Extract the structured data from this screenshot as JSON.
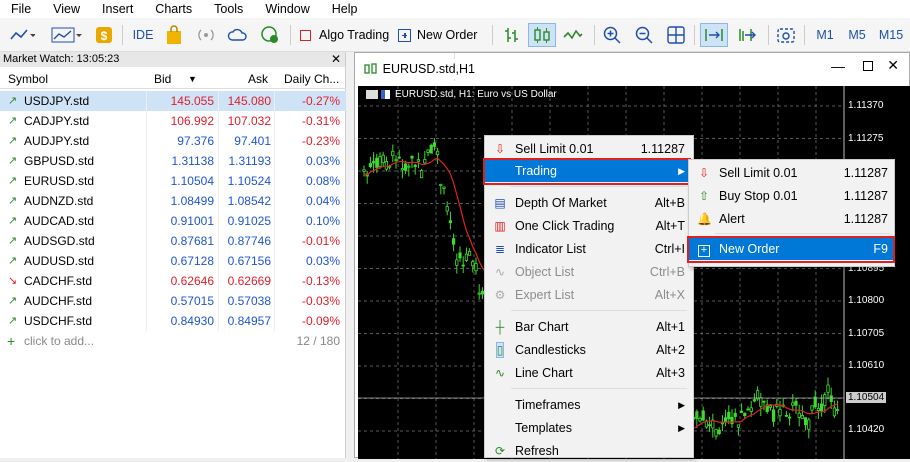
{
  "menu": {
    "file": "File",
    "view": "View",
    "insert": "Insert",
    "charts": "Charts",
    "tools": "Tools",
    "window": "Window",
    "help": "Help"
  },
  "toolbar": {
    "ide": "IDE",
    "algo": "Algo Trading",
    "new_order": "New Order",
    "m1": "M1",
    "m5": "M5",
    "m15": "M15"
  },
  "market_watch": {
    "title": "Market Watch: 13:05:23",
    "headers": {
      "symbol": "Symbol",
      "bid": "Bid",
      "ask": "Ask",
      "change": "Daily Ch..."
    },
    "rows": [
      {
        "symbol": "USDJPY.std",
        "bid": "145.055",
        "ask": "145.080",
        "change": "-0.27%",
        "dir": "up",
        "bid_color": "#e0202a",
        "chg_color": "#e0202a",
        "selected": true
      },
      {
        "symbol": "CADJPY.std",
        "bid": "106.992",
        "ask": "107.032",
        "change": "-0.31%",
        "dir": "up",
        "bid_color": "#e0202a",
        "chg_color": "#e0202a"
      },
      {
        "symbol": "AUDJPY.std",
        "bid": "97.376",
        "ask": "97.401",
        "change": "-0.23%",
        "dir": "up",
        "bid_color": "#1f55d6",
        "chg_color": "#e0202a"
      },
      {
        "symbol": "GBPUSD.std",
        "bid": "1.31138",
        "ask": "1.31193",
        "change": "0.03%",
        "dir": "up",
        "bid_color": "#1f55d6",
        "chg_color": "#1f55d6"
      },
      {
        "symbol": "EURUSD.std",
        "bid": "1.10504",
        "ask": "1.10524",
        "change": "0.08%",
        "dir": "up",
        "bid_color": "#1f55d6",
        "chg_color": "#1f55d6"
      },
      {
        "symbol": "AUDNZD.std",
        "bid": "1.08499",
        "ask": "1.08542",
        "change": "0.04%",
        "dir": "up",
        "bid_color": "#1f55d6",
        "chg_color": "#1f55d6"
      },
      {
        "symbol": "AUDCAD.std",
        "bid": "0.91001",
        "ask": "0.91025",
        "change": "0.10%",
        "dir": "up",
        "bid_color": "#1f55d6",
        "chg_color": "#1f55d6"
      },
      {
        "symbol": "AUDSGD.std",
        "bid": "0.87681",
        "ask": "0.87746",
        "change": "-0.01%",
        "dir": "up",
        "bid_color": "#1f55d6",
        "chg_color": "#e0202a"
      },
      {
        "symbol": "AUDUSD.std",
        "bid": "0.67128",
        "ask": "0.67156",
        "change": "0.03%",
        "dir": "up",
        "bid_color": "#1f55d6",
        "chg_color": "#1f55d6"
      },
      {
        "symbol": "CADCHF.std",
        "bid": "0.62646",
        "ask": "0.62669",
        "change": "-0.13%",
        "dir": "down",
        "bid_color": "#e0202a",
        "chg_color": "#e0202a"
      },
      {
        "symbol": "AUDCHF.std",
        "bid": "0.57015",
        "ask": "0.57038",
        "change": "-0.03%",
        "dir": "up",
        "bid_color": "#1f55d6",
        "chg_color": "#e0202a"
      },
      {
        "symbol": "USDCHF.std",
        "bid": "0.84930",
        "ask": "0.84957",
        "change": "-0.09%",
        "dir": "up",
        "bid_color": "#1f55d6",
        "chg_color": "#e0202a"
      }
    ],
    "add_label": "click to add...",
    "count": "12 / 180"
  },
  "chart": {
    "tab_title": "EURUSD.std,H1",
    "header": "EURUSD.std, H1:  Euro vs US Dollar",
    "price_labels": [
      "1.11370",
      "1.11275",
      "1.11180",
      "1.11085",
      "1.10990",
      "1.10895",
      "1.10800",
      "1.10705",
      "1.10610",
      "1.10504",
      "1.10420"
    ],
    "current_price": "1.10504"
  },
  "context_menu": {
    "items": [
      {
        "label": "Sell Limit 0.01",
        "key": "1.11287",
        "icon": "sell-limit-icon"
      },
      {
        "label": "Trading",
        "key": "",
        "icon": "",
        "submenu": true,
        "highlighted": true
      },
      {
        "label": "Depth Of Market",
        "key": "Alt+B",
        "icon": "depth-of-market-icon"
      },
      {
        "label": "One Click Trading",
        "key": "Alt+T",
        "icon": "one-click-trading-icon"
      },
      {
        "label": "Indicator List",
        "key": "Ctrl+I",
        "icon": "indicator-list-icon"
      },
      {
        "label": "Object List",
        "key": "Ctrl+B",
        "icon": "object-list-icon",
        "disabled": true
      },
      {
        "label": "Expert List",
        "key": "Alt+X",
        "icon": "expert-list-icon",
        "disabled": true
      },
      {
        "label": "Bar Chart",
        "key": "Alt+1",
        "icon": "bar-chart-icon"
      },
      {
        "label": "Candlesticks",
        "key": "Alt+2",
        "icon": "candlesticks-icon"
      },
      {
        "label": "Line Chart",
        "key": "Alt+3",
        "icon": "line-chart-icon"
      },
      {
        "label": "Timeframes",
        "key": "",
        "submenu": true
      },
      {
        "label": "Templates",
        "key": "",
        "submenu": true
      },
      {
        "label": "Refresh",
        "key": "",
        "icon": "refresh-icon"
      }
    ]
  },
  "submenu": {
    "items": [
      {
        "label": "Sell Limit 0.01",
        "key": "1.11287",
        "icon": "sell-limit-icon"
      },
      {
        "label": "Buy Stop 0.01",
        "key": "1.11287",
        "icon": "buy-stop-icon"
      },
      {
        "label": "Alert",
        "key": "1.11287",
        "icon": "bell-icon"
      },
      {
        "label": "New Order",
        "key": "F9",
        "icon": "new-order-icon",
        "highlighted": true
      }
    ]
  }
}
